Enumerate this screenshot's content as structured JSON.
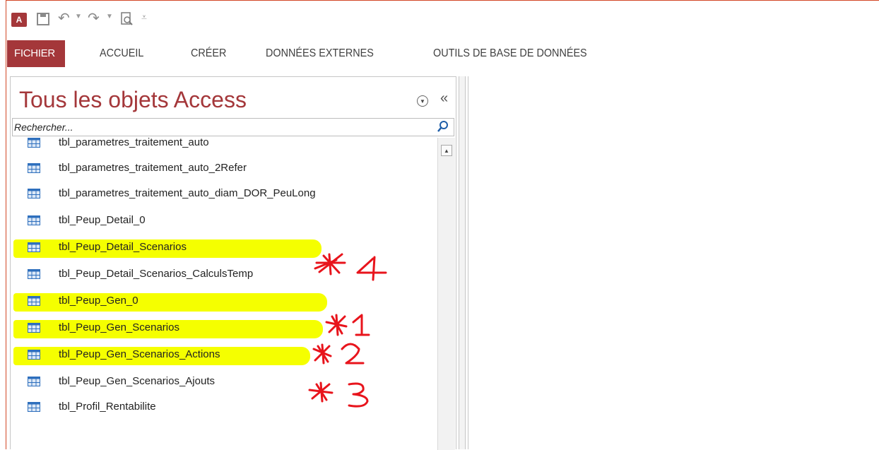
{
  "qat": {
    "logo_text": "A",
    "icons": [
      "access-logo-icon",
      "save-icon",
      "undo-icon",
      "redo-icon",
      "print-preview-icon",
      "customize-icon"
    ]
  },
  "ribbon": {
    "tabs": [
      {
        "label": "FICHIER",
        "active": true
      },
      {
        "label": "ACCUEIL"
      },
      {
        "label": "CRÉER"
      },
      {
        "label": "DONNÉES EXTERNES"
      },
      {
        "label": "OUTILS DE BASE DE DONNÉES"
      }
    ]
  },
  "nav": {
    "title": "Tous les objets Access",
    "search_placeholder": "Rechercher...",
    "items": [
      {
        "label": "tbl_parametres_traitement_auto",
        "highlighted": false
      },
      {
        "label": "tbl_parametres_traitement_auto_2Refer",
        "highlighted": false
      },
      {
        "label": "tbl_parametres_traitement_auto_diam_DOR_PeuLong",
        "highlighted": false
      },
      {
        "label": "tbl_Peup_Detail_0",
        "highlighted": false
      },
      {
        "label": "tbl_Peup_Detail_Scenarios",
        "highlighted": true,
        "annotation": "4"
      },
      {
        "label": "tbl_Peup_Detail_Scenarios_CalculsTemp",
        "highlighted": false
      },
      {
        "label": "tbl_Peup_Gen_0",
        "highlighted": true,
        "annotation": "1"
      },
      {
        "label": "tbl_Peup_Gen_Scenarios",
        "highlighted": true,
        "annotation": "2"
      },
      {
        "label": "tbl_Peup_Gen_Scenarios_Actions",
        "highlighted": true,
        "annotation": "3"
      },
      {
        "label": "tbl_Peup_Gen_Scenarios_Ajouts",
        "highlighted": false
      },
      {
        "label": "tbl_Profil_Rentabilite",
        "highlighted": false
      }
    ]
  },
  "colors": {
    "accent": "#a4373a",
    "highlight": "#f5ff00",
    "annotation": "#e8141c",
    "table_icon": "#2e6fbd"
  }
}
